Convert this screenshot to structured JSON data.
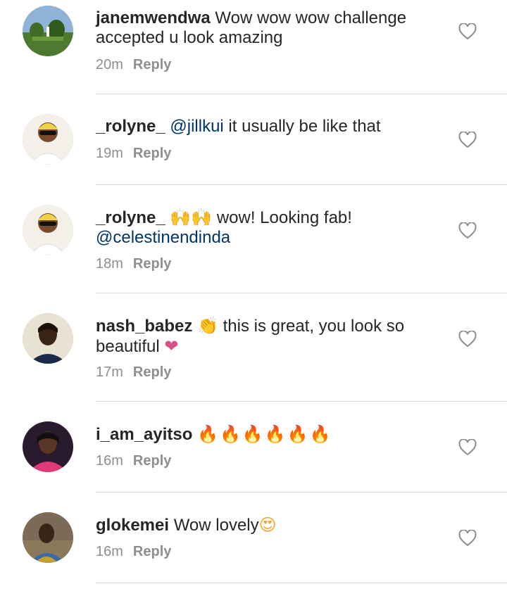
{
  "comments": [
    {
      "user": "janemwendwa",
      "mention": "",
      "text": " Wow wow wow challenge accepted u look amazing",
      "emoji": "",
      "time": "20m",
      "reply": "Reply",
      "avatar_icon": "landscape-avatar"
    },
    {
      "user": "_rolyne_",
      "mention": "@jillkui",
      "text": " it usually be like that ",
      "emoji": "",
      "time": "19m",
      "reply": "Reply",
      "avatar_icon": "woman-sunglasses-avatar"
    },
    {
      "user": "_rolyne_",
      "mention": "@celestinendinda",
      "text": " wow! Looking fab!",
      "emoji": "🙌🙌",
      "time": "18m",
      "reply": "Reply",
      "avatar_icon": "woman-sunglasses-avatar"
    },
    {
      "user": "nash_babez",
      "mention": "",
      "text": " this is great, you look so beautiful ",
      "emoji": "👏",
      "emoji2": "❤",
      "time": "17m",
      "reply": "Reply",
      "avatar_icon": "woman-avatar"
    },
    {
      "user": "i_am_ayitso",
      "mention": "",
      "text": "",
      "emoji": "🔥🔥🔥🔥🔥🔥",
      "time": "16m",
      "reply": "Reply",
      "avatar_icon": "woman-pink-avatar"
    },
    {
      "user": "glokemei",
      "mention": "",
      "text": " Wow lovely",
      "emoji": "😍",
      "time": "16m",
      "reply": "Reply",
      "avatar_icon": "woman-outdoor-avatar"
    }
  ],
  "colors": {
    "username": "#262626",
    "mention": "#003569",
    "meta": "#8e8e8e",
    "divider": "#dbdbdb"
  }
}
